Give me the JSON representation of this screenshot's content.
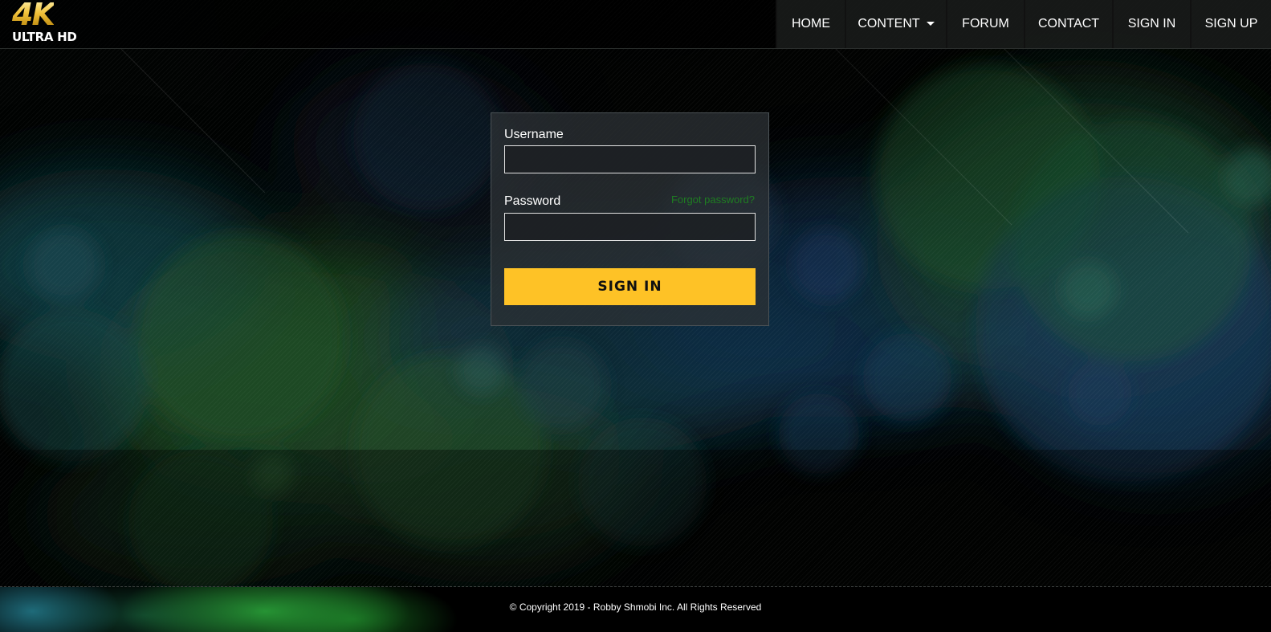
{
  "logo": {
    "main": "4K",
    "sub": "ULTRA HD"
  },
  "nav": {
    "items": [
      {
        "label": "HOME"
      },
      {
        "label": "CONTENT",
        "has_dropdown": true
      },
      {
        "label": "FORUM"
      },
      {
        "label": "CONTACT"
      },
      {
        "label": "SIGN IN"
      },
      {
        "label": "SIGN UP"
      }
    ]
  },
  "login": {
    "username_label": "Username",
    "username_value": "",
    "password_label": "Password",
    "password_value": "",
    "forgot_label": "Forgot password?",
    "submit_label": "SIGN IN"
  },
  "footer": {
    "copyright": "© Copyright 2019 - Robby Shmobi Inc. All Rights Reserved"
  },
  "colors": {
    "accent": "#fec226",
    "link": "#1f7d22",
    "background": "#020403"
  }
}
